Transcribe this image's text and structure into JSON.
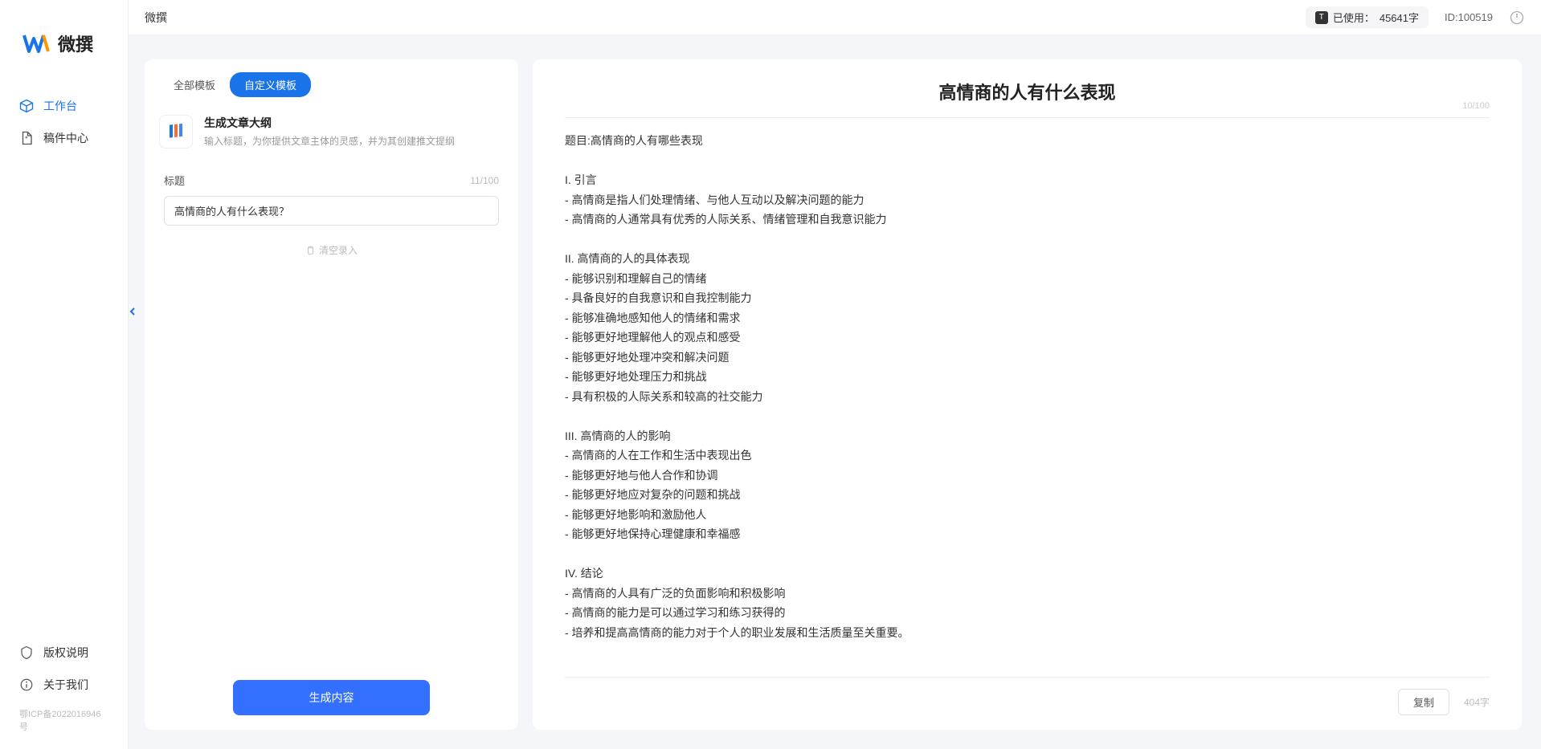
{
  "app": {
    "brand": "微撰"
  },
  "sidebar": {
    "nav": [
      {
        "label": "工作台"
      },
      {
        "label": "稿件中心"
      }
    ],
    "footer": [
      {
        "label": "版权说明"
      },
      {
        "label": "关于我们"
      }
    ],
    "icp": "鄂ICP备2022016946号"
  },
  "topbar": {
    "title": "微撰",
    "usage_prefix": "已使用：",
    "usage_value": "45641字",
    "user_id": "ID:100519"
  },
  "left": {
    "tabs": [
      {
        "label": "全部模板"
      },
      {
        "label": "自定义模板"
      }
    ],
    "template": {
      "title": "生成文章大纲",
      "desc": "输入标题，为你提供文章主体的灵感，并为其创建推文提纲"
    },
    "form": {
      "label": "标题",
      "char_count": "11/100",
      "value": "高情商的人有什么表现？",
      "clear": "清空录入"
    },
    "generate_btn": "生成内容"
  },
  "right": {
    "title": "高情商的人有什么表现",
    "title_count": "10/100",
    "body": "题目:高情商的人有哪些表现\n\nI. 引言\n- 高情商是指人们处理情绪、与他人互动以及解决问题的能力\n- 高情商的人通常具有优秀的人际关系、情绪管理和自我意识能力\n\nII. 高情商的人的具体表现\n- 能够识别和理解自己的情绪\n- 具备良好的自我意识和自我控制能力\n- 能够准确地感知他人的情绪和需求\n- 能够更好地理解他人的观点和感受\n- 能够更好地处理冲突和解决问题\n- 能够更好地处理压力和挑战\n- 具有积极的人际关系和较高的社交能力\n\nIII. 高情商的人的影响\n- 高情商的人在工作和生活中表现出色\n- 能够更好地与他人合作和协调\n- 能够更好地应对复杂的问题和挑战\n- 能够更好地影响和激励他人\n- 能够更好地保持心理健康和幸福感\n\nIV. 结论\n- 高情商的人具有广泛的负面影响和积极影响\n- 高情商的能力是可以通过学习和练习获得的\n- 培养和提高高情商的能力对于个人的职业发展和生活质量至关重要。",
    "copy_btn": "复制",
    "word_count": "404字"
  }
}
